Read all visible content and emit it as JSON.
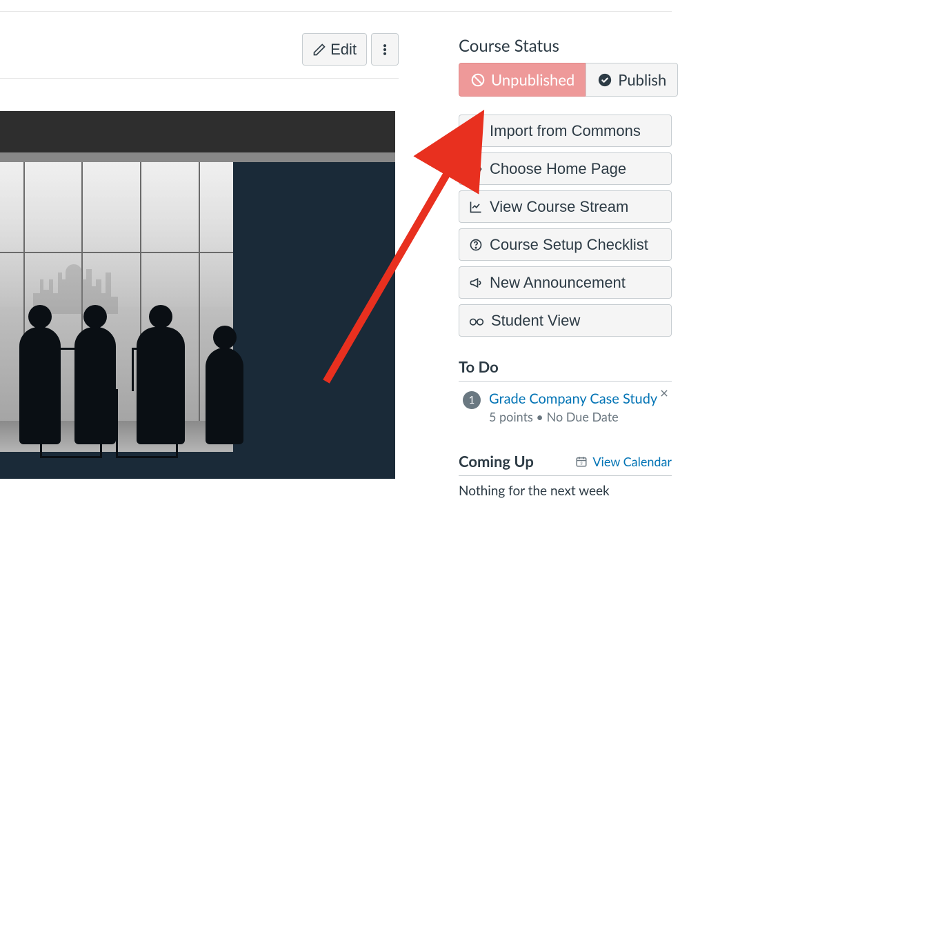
{
  "toolbar": {
    "edit_label": "Edit"
  },
  "sidebar": {
    "status_heading": "Course Status",
    "unpublished_label": "Unpublished",
    "publish_label": "Publish",
    "actions": [
      "Import from Commons",
      "Choose Home Page",
      "View Course Stream",
      "Course Setup Checklist",
      "New Announcement",
      "Student View"
    ],
    "todo_heading": "To Do",
    "todo": {
      "badge": "1",
      "title": "Grade Company Case Study",
      "meta": "5 points • No Due Date"
    },
    "coming_up_heading": "Coming Up",
    "view_calendar": "View Calendar",
    "coming_empty": "Nothing for the next week"
  }
}
